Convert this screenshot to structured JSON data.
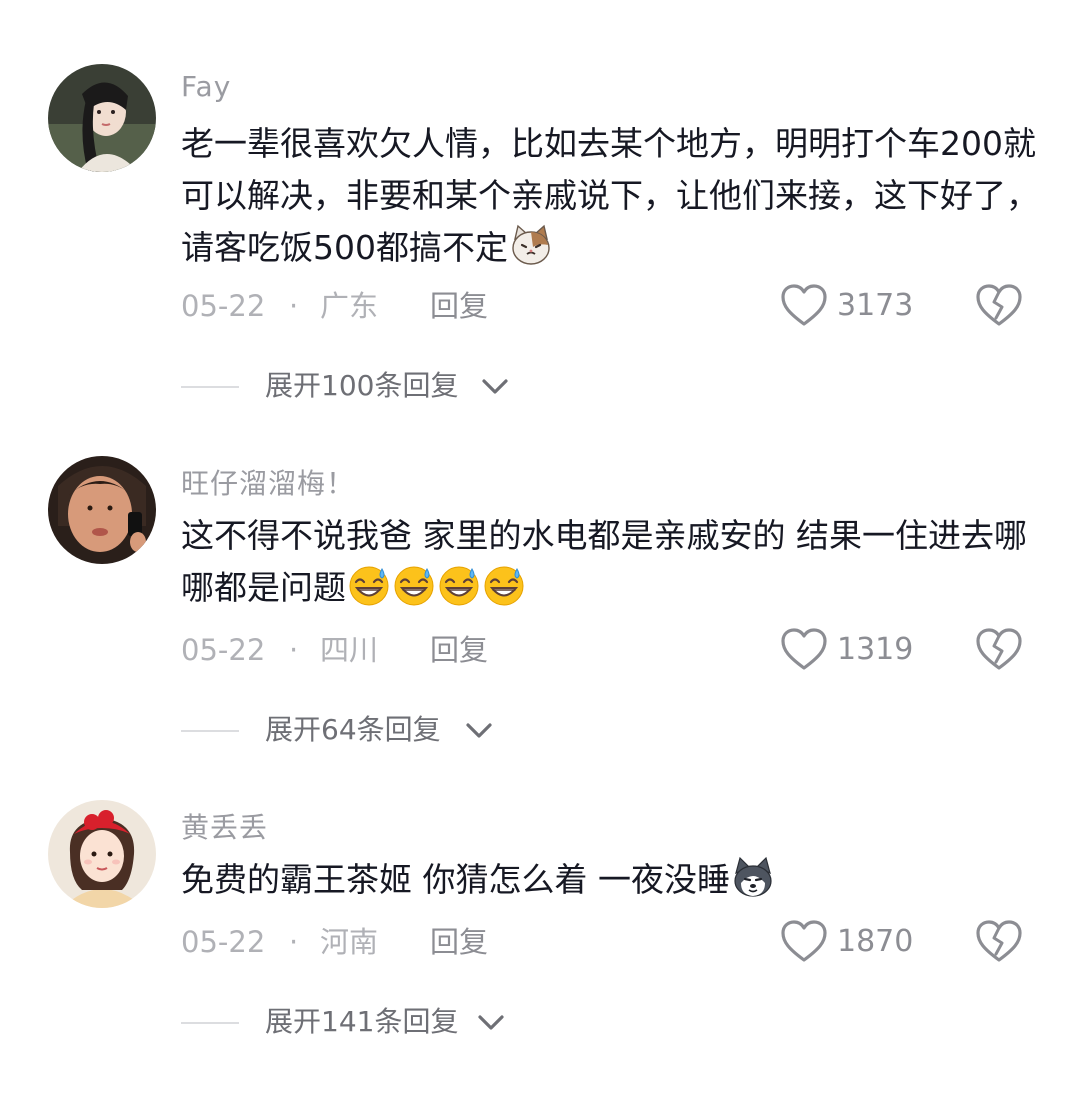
{
  "comments": [
    {
      "username": "Fay",
      "text": "老一辈很喜欢欠人情，比如去某个地方，明明打个车200就可以解决，非要和某个亲戚说下，让他们来接，这下好了，请客吃饭500都搞不定",
      "date": "05-22",
      "separator": "·",
      "location": "广东",
      "reply_label": "回复",
      "likes": "3173",
      "expand_label": "展开100条回复",
      "avatar_icon": "woman-portrait-avatar",
      "trailing_emoji": "cat-face-emoji"
    },
    {
      "username": "旺仔溜溜梅！",
      "text": "这不得不说我爸 家里的水电都是亲戚安的 结果一住进去哪哪都是问题",
      "date": "05-22",
      "separator": "·",
      "location": "四川",
      "reply_label": "回复",
      "likes": "1319",
      "expand_label": "展开64条回复",
      "avatar_icon": "man-selfie-avatar",
      "trailing_emoji": "grinning-sweat-emoji x4"
    },
    {
      "username": "黄丢丢",
      "text": "免费的霸王茶姬 你猜怎么着 一夜没睡",
      "date": "05-22",
      "separator": "·",
      "location": "河南",
      "reply_label": "回复",
      "likes": "1870",
      "expand_label": "展开141条回复",
      "avatar_icon": "girl-red-headband-avatar",
      "trailing_emoji": "husky-dog-emoji"
    }
  ],
  "colors": {
    "text": "#161823",
    "muted": "#b0b1b6",
    "username": "#9a9ba1",
    "icon": "#8c8d93",
    "background": "#ffffff"
  }
}
